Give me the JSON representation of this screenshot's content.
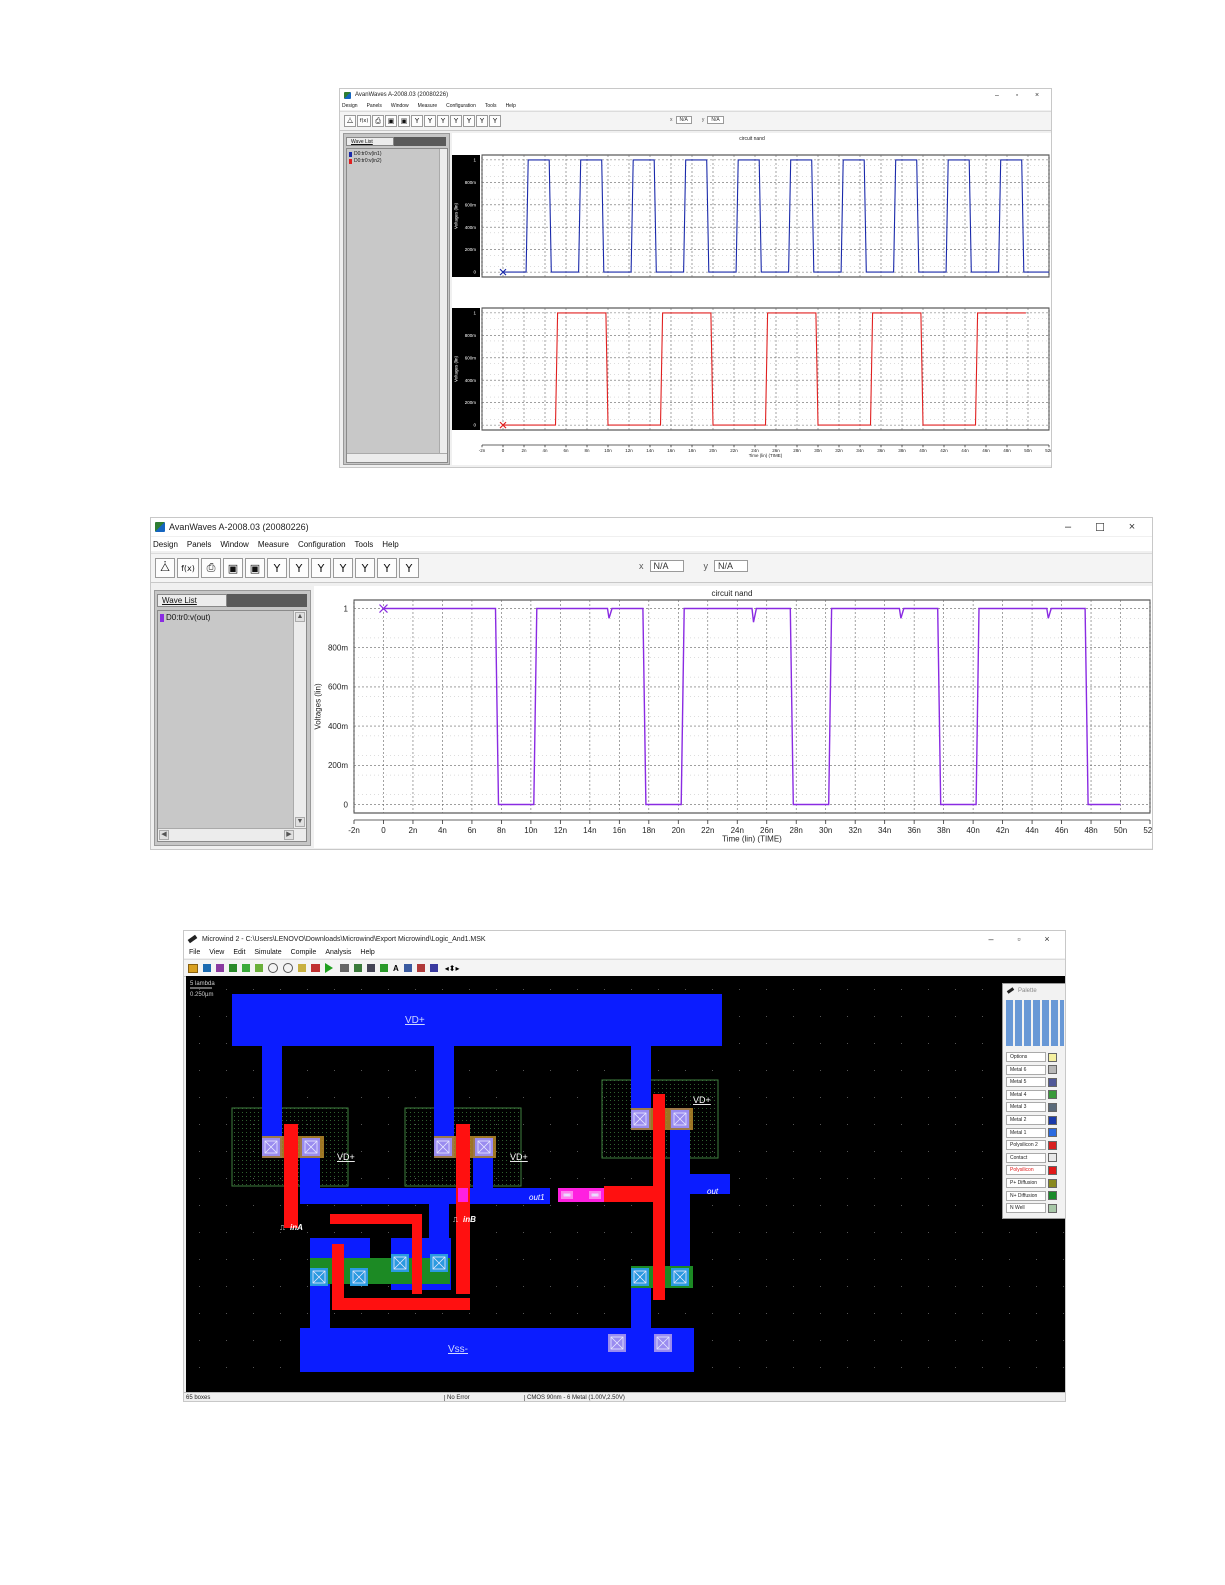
{
  "win1": {
    "title": "AvanWaves A-2008.03 (20080226)",
    "menu": [
      "Design",
      "Panels",
      "Window",
      "Measure",
      "Configuration",
      "Tools",
      "Help"
    ],
    "window_controls": [
      "–",
      "▫",
      "×"
    ],
    "toolbar_icons": [
      "⧊",
      "f(x)",
      "⎙",
      "▣",
      "▣",
      "Y",
      "Y",
      "Y",
      "Y",
      "Y",
      "Y",
      "Y"
    ],
    "x_readout": "N/A",
    "y_readout": "N/A",
    "wave_list_label": "Wave List",
    "waves": [
      {
        "label": "D0:tr0:v(in1)",
        "color": "#1a2aaa"
      },
      {
        "label": "D0:tr0:v(in2)",
        "color": "#e02020"
      }
    ],
    "plot_title": "circuit nand",
    "ylabel": "Voltages (lin)",
    "xlabel": "Time (lin) (TIME)",
    "y_ticks": [
      "1",
      "800m",
      "600m",
      "400m",
      "200m",
      "0"
    ],
    "x_ticks": [
      "-2n",
      "0",
      "2n",
      "4n",
      "6n",
      "8n",
      "10n",
      "12n",
      "14n",
      "16n",
      "18n",
      "20n",
      "22n",
      "24n",
      "26n",
      "28n",
      "30n",
      "32n",
      "34n",
      "36n",
      "38n",
      "40n",
      "42n",
      "44n",
      "46n",
      "48n",
      "50n",
      "52n"
    ]
  },
  "win2": {
    "title": "AvanWaves A-2008.03 (20080226)",
    "menu": [
      "Design",
      "Panels",
      "Window",
      "Measure",
      "Configuration",
      "Tools",
      "Help"
    ],
    "window_controls": [
      "–",
      "☐",
      "×"
    ],
    "toolbar_icons": [
      "⧊",
      "f(x)",
      "⎙",
      "▣",
      "▣",
      "Y",
      "Y",
      "Y",
      "Y",
      "Y",
      "Y",
      "Y"
    ],
    "x_readout": "N/A",
    "y_readout": "N/A",
    "wave_list_label": "Wave List",
    "waves": [
      {
        "label": "D0:tr0:v(out)",
        "color": "#8a2be2"
      }
    ],
    "plot_title": "circuit nand",
    "ylabel": "Voltages (lin)",
    "xlabel": "Time (lin) (TIME)",
    "y_ticks": [
      "1",
      "800m",
      "600m",
      "400m",
      "200m",
      "0"
    ],
    "x_ticks": [
      "-2n",
      "0",
      "2n",
      "4n",
      "6n",
      "8n",
      "10n",
      "12n",
      "14n",
      "16n",
      "18n",
      "20n",
      "22n",
      "24n",
      "26n",
      "28n",
      "30n",
      "32n",
      "34n",
      "36n",
      "38n",
      "40n",
      "42n",
      "44n",
      "46n",
      "48n",
      "50n",
      "52n"
    ]
  },
  "win3": {
    "title": "Microwind 2 - C:\\Users\\LENOVO\\Downloads\\Microwind\\Export Microwind\\Logic_And1.MSK",
    "menu": [
      "File",
      "View",
      "Edit",
      "Simulate",
      "Compile",
      "Analysis",
      "Help"
    ],
    "window_controls": [
      "–",
      "▫",
      "×"
    ],
    "scale_label": "5 lambda",
    "scale_value": "0.250µm",
    "layout_labels": {
      "vdd_top": "VD+",
      "vdd_left": "VD+",
      "vdd_mid": "VD+",
      "vdd_right": "VD+",
      "out1": "out1",
      "out": "out",
      "inA": "inA",
      "inB": "inB",
      "vss": "Vss-"
    },
    "status": {
      "boxes": "65 boxes",
      "error": "No Error",
      "tech": "CMOS 90nm - 6 Metal (1.00V,2.50V)"
    },
    "palette_title": "Palette",
    "palette_layers": [
      {
        "label": "Options",
        "color": "#f5f0a0"
      },
      {
        "label": "Metal 6",
        "color": "#b8b8b8"
      },
      {
        "label": "Metal 5",
        "color": "#505898"
      },
      {
        "label": "Metal 4",
        "color": "#3a9a3a"
      },
      {
        "label": "Metal 3",
        "color": "#5a6a7a"
      },
      {
        "label": "Metal 2",
        "color": "#1a3aaa"
      },
      {
        "label": "Metal 1",
        "color": "#2a6ae0"
      },
      {
        "label": "Polysilicon 2",
        "color": "#d82020"
      },
      {
        "label": "Contact",
        "color": "#e8e8e8"
      },
      {
        "label": "Polysilicon",
        "color": "#e01818"
      },
      {
        "label": "P+ Diffusion",
        "color": "#8a8a20"
      },
      {
        "label": "N+ Diffusion",
        "color": "#1a8a2a"
      },
      {
        "label": "N Well",
        "color": "#a8c8a8"
      }
    ]
  },
  "chart_data": [
    {
      "type": "line",
      "title": "circuit nand",
      "xlabel": "Time (lin) (TIME)",
      "ylabel": "Voltages (lin)",
      "xlim": [
        -2,
        52
      ],
      "ylim": [
        0,
        1
      ],
      "series": [
        {
          "name": "D0:tr0:v(in1)",
          "color": "#1a2aaa",
          "x": [
            0,
            2.2,
            2.4,
            4.4,
            4.6,
            7.2,
            7.4,
            9.4,
            9.6,
            12.2,
            12.4,
            14.4,
            14.6,
            17.2,
            17.4,
            19.4,
            19.6,
            22.2,
            22.4,
            24.4,
            24.6,
            27.2,
            27.4,
            29.4,
            29.6,
            32.2,
            32.4,
            34.4,
            34.6,
            37.2,
            37.4,
            39.4,
            39.6,
            42.2,
            42.4,
            44.4,
            44.6,
            47.2,
            47.4,
            49.4,
            49.6,
            52
          ],
          "y": [
            0,
            0,
            1,
            1,
            0,
            0,
            1,
            1,
            0,
            0,
            1,
            1,
            0,
            0,
            1,
            1,
            0,
            0,
            1,
            1,
            0,
            0,
            1,
            1,
            0,
            0,
            1,
            1,
            0,
            0,
            1,
            1,
            0,
            0,
            1,
            1,
            0,
            0,
            1,
            1,
            0,
            0
          ]
        },
        {
          "name": "D0:tr0:v(in2)",
          "color": "#e02020",
          "x": [
            0,
            5.0,
            5.2,
            9.8,
            10.0,
            15.0,
            15.2,
            19.8,
            20.0,
            25.0,
            25.2,
            29.8,
            30.0,
            35.0,
            35.2,
            39.8,
            40.0,
            45.0,
            45.2,
            49.8
          ],
          "y": [
            0,
            0,
            1,
            1,
            0,
            0,
            1,
            1,
            0,
            0,
            1,
            1,
            0,
            0,
            1,
            1,
            0,
            0,
            1,
            1
          ]
        }
      ]
    },
    {
      "type": "line",
      "title": "circuit nand",
      "xlabel": "Time (lin) (TIME)",
      "ylabel": "Voltages (lin)",
      "xlim": [
        -2,
        52
      ],
      "ylim": [
        0,
        1
      ],
      "series": [
        {
          "name": "D0:tr0:v(out)",
          "color": "#8a2be2",
          "x": [
            0,
            7.6,
            7.8,
            10.2,
            10.4,
            15.2,
            15.3,
            15.5,
            17.6,
            17.8,
            20.2,
            20.4,
            25.0,
            25.1,
            25.3,
            27.6,
            27.8,
            30.2,
            30.4,
            35.0,
            35.1,
            35.3,
            37.6,
            37.8,
            40.2,
            40.4,
            45.0,
            45.1,
            45.3,
            47.6,
            47.8,
            50
          ],
          "y": [
            1,
            1,
            0,
            0,
            1,
            1,
            0.95,
            1,
            1,
            0,
            0,
            1,
            1,
            0.93,
            1,
            1,
            0,
            0,
            1,
            1,
            0.95,
            1,
            1,
            0,
            0,
            1,
            1,
            0.95,
            1,
            1,
            0,
            0
          ]
        }
      ]
    }
  ]
}
